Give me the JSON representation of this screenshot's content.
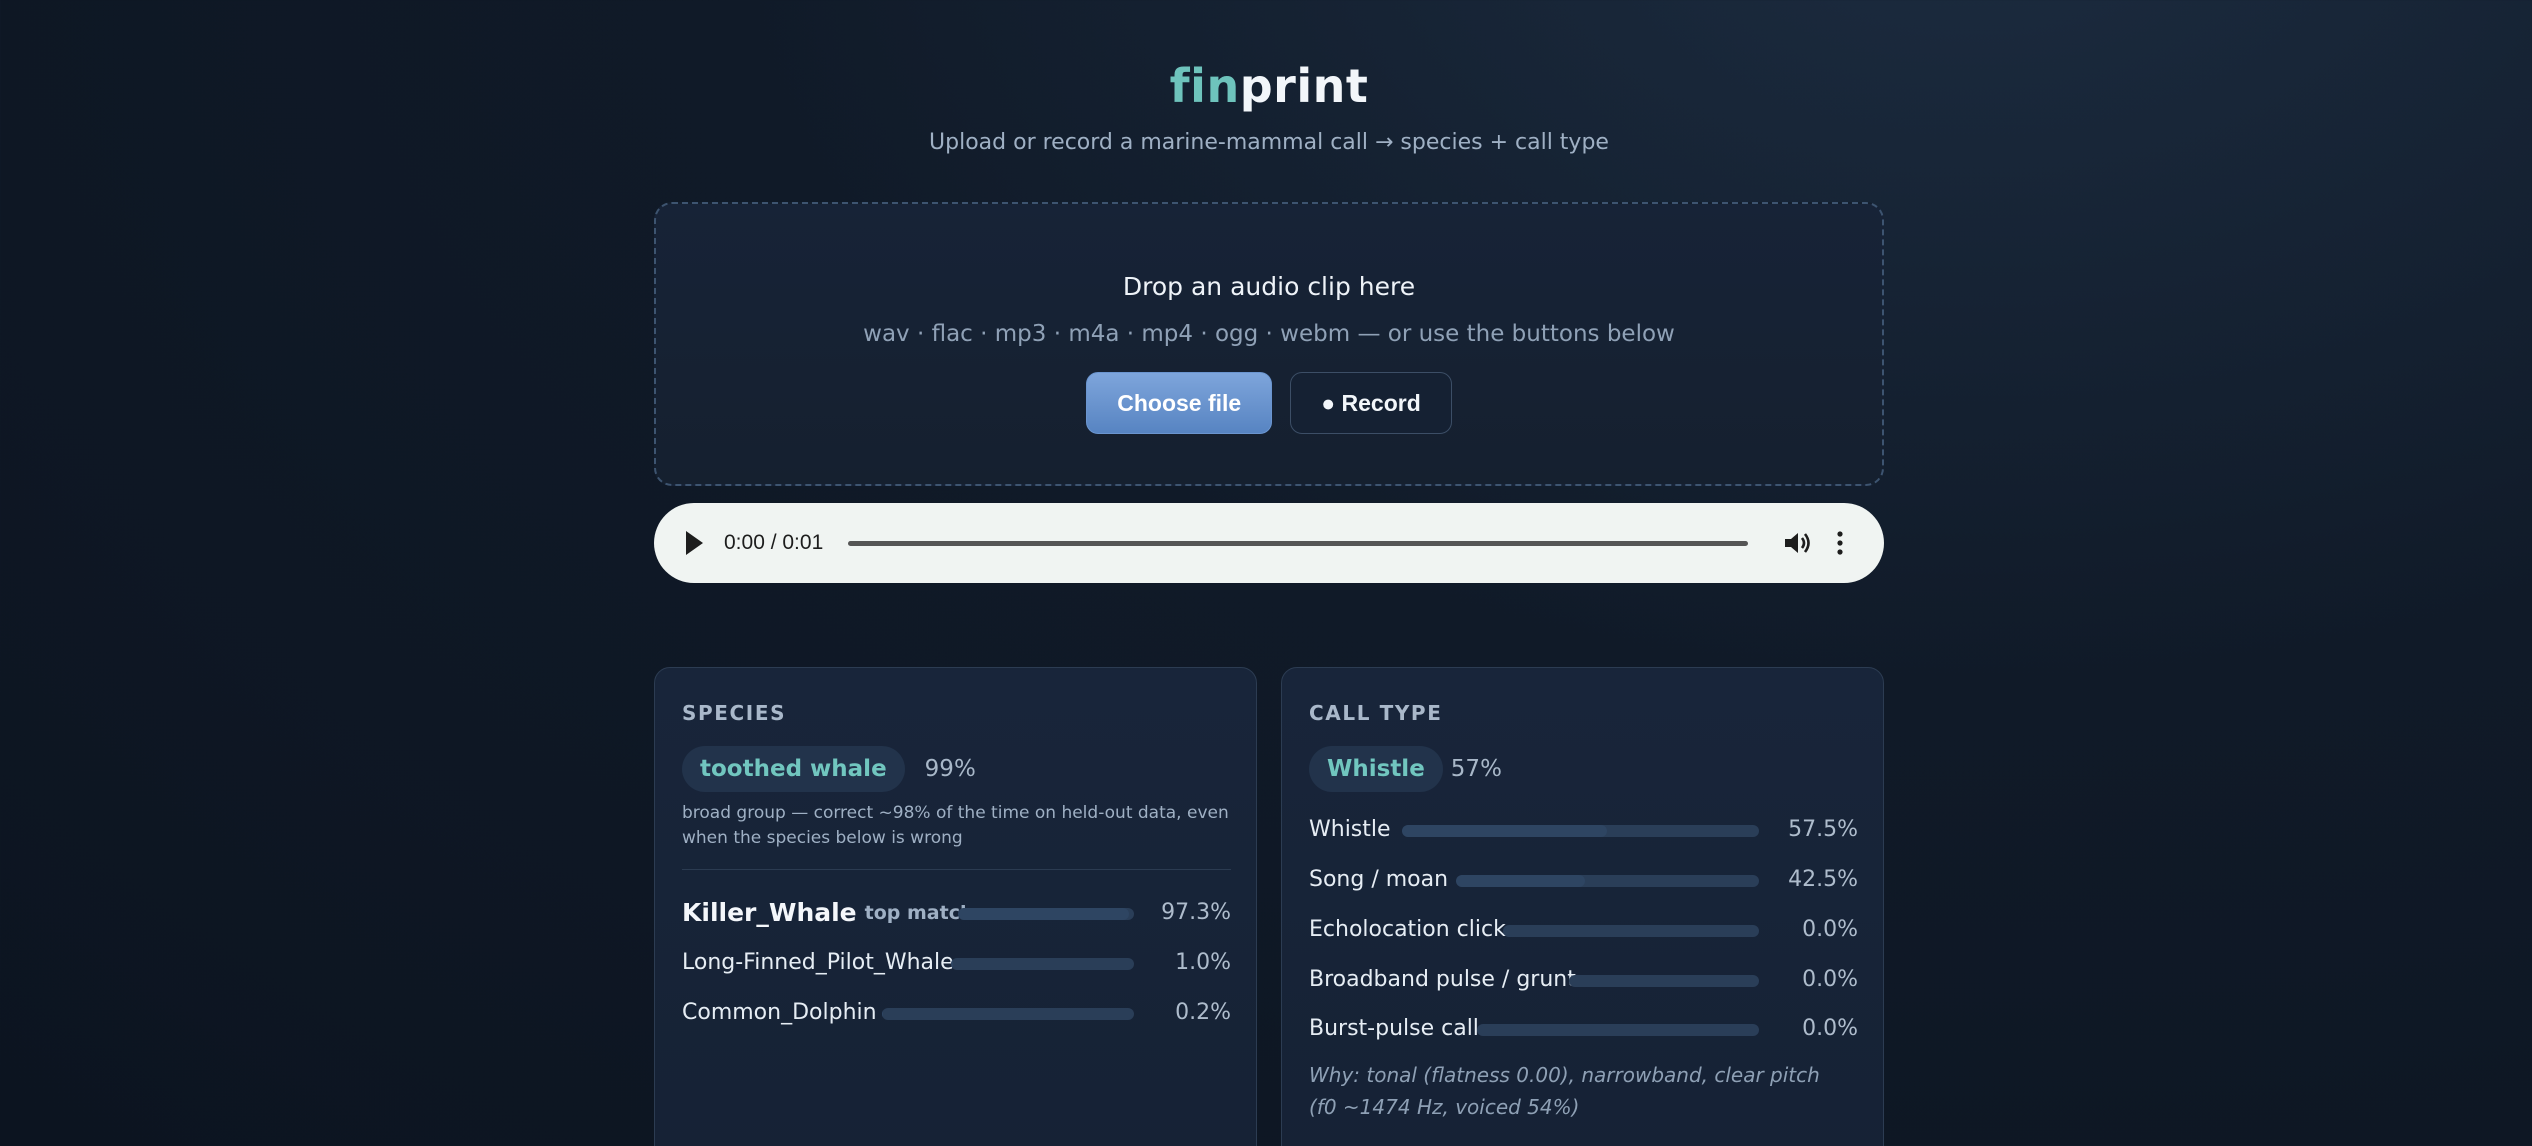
{
  "brand": {
    "part1": "fin",
    "part2": "print",
    "accent_color": "#6ec3bc"
  },
  "tagline": "Upload or record a marine-mammal call → species + call type",
  "dropzone": {
    "title": "Drop an audio clip here",
    "formats": "wav · flac · mp3 · m4a · mp4 · ogg · webm — or use the buttons below",
    "choose_label": "Choose file",
    "record_label": "● Record"
  },
  "player": {
    "time": "0:00 / 0:01",
    "progress": 0,
    "icons": [
      "play-icon",
      "volume-icon",
      "more-vert-icon"
    ]
  },
  "species": {
    "label": "SPECIES",
    "group": "toothed whale",
    "group_pct": "99%",
    "note": "broad group — correct ~98% of the time on held-out data, even when the species below is wrong",
    "top_tag": "top match",
    "items": [
      {
        "name": "Killer_Whale",
        "pct": "97.3%",
        "value": 97.3
      },
      {
        "name": "Long-Finned_Pilot_Whale",
        "pct": "1.0%",
        "value": 1.0
      },
      {
        "name": "Common_Dolphin",
        "pct": "0.2%",
        "value": 0.2
      }
    ]
  },
  "calltype": {
    "label": "CALL TYPE",
    "top": "Whistle",
    "top_pct": "57%",
    "items": [
      {
        "name": "Whistle",
        "pct": "57.5%",
        "value": 57.5
      },
      {
        "name": "Song / moan",
        "pct": "42.5%",
        "value": 42.5
      },
      {
        "name": "Echolocation click",
        "pct": "0.0%",
        "value": 0.0
      },
      {
        "name": "Broadband pulse / grunt",
        "pct": "0.0%",
        "value": 0.0
      },
      {
        "name": "Burst-pulse call",
        "pct": "0.0%",
        "value": 0.0
      }
    ],
    "why": "Why: tonal (flatness 0.00), narrowband, clear pitch (f0 ~1474 Hz, voiced 54%)"
  }
}
